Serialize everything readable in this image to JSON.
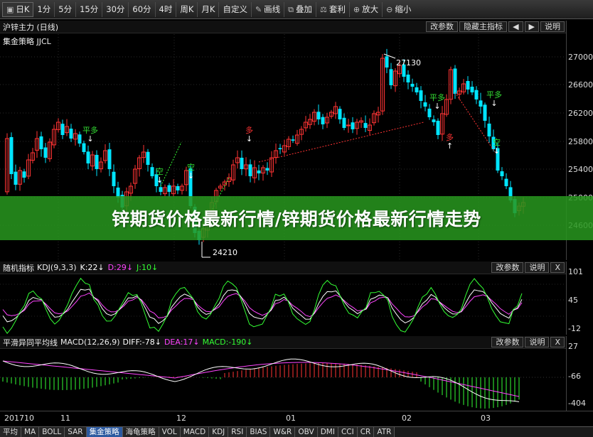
{
  "toolbar": {
    "items": [
      {
        "label": "日K",
        "icon": "checkbox-icon",
        "active": true
      },
      {
        "label": "1分"
      },
      {
        "label": "5分"
      },
      {
        "label": "15分"
      },
      {
        "label": "30分"
      },
      {
        "label": "60分"
      },
      {
        "label": "4时"
      },
      {
        "label": "周K"
      },
      {
        "label": "月K"
      },
      {
        "label": "自定义"
      },
      {
        "label": "画线",
        "icon": "pencil-icon"
      },
      {
        "label": "叠加",
        "icon": "overlay-icon"
      },
      {
        "label": "套利",
        "icon": "arbitrage-icon"
      },
      {
        "label": "放大",
        "icon": "zoom-in-icon"
      },
      {
        "label": "缩小",
        "icon": "zoom-out-icon"
      }
    ]
  },
  "main_panel": {
    "title": "沪锌主力 (日线)",
    "strategy_label": "集金策略 JJCL",
    "buttons": {
      "params": "改参数",
      "hide": "隐藏主指标",
      "prev": "◀",
      "next": "▶",
      "help": "说明"
    },
    "y_ticks": [
      "27000",
      "26600",
      "26200",
      "25800",
      "25400",
      "25000",
      "24600"
    ],
    "high_label": "27130",
    "low_label": "24210",
    "signals": [
      {
        "text": "平多",
        "color": "#33dd33"
      },
      {
        "text": "空",
        "color": "#33dd33"
      },
      {
        "text": "空",
        "color": "#33dd33"
      },
      {
        "text": "多",
        "color": "#ff3333"
      },
      {
        "text": "平多",
        "color": "#33dd33"
      },
      {
        "text": "多",
        "color": "#ff3333"
      },
      {
        "text": "平多",
        "color": "#33dd33"
      },
      {
        "text": "空",
        "color": "#33dd33"
      }
    ]
  },
  "banner": {
    "text": "锌期货价格最新行情/锌期货价格最新行情走势"
  },
  "kdj_panel": {
    "name": "随机指标",
    "params": "KDJ(9,3,3)",
    "k": "K:22↓",
    "d": "D:29↓",
    "j": "J:10↓",
    "buttons": {
      "params": "改参数",
      "help": "说明",
      "close": "X"
    },
    "y_ticks": [
      "101",
      "45",
      "-12"
    ]
  },
  "macd_panel": {
    "name": "平滑异同平均线",
    "params": "MACD(12,26,9)",
    "diff": "DIFF:-78↓",
    "dea": "DEA:17↓",
    "macd": "MACD:-190↓",
    "buttons": {
      "params": "改参数",
      "help": "说明",
      "close": "X"
    },
    "y_ticks": [
      "27",
      "-66",
      "-404"
    ]
  },
  "x_axis": {
    "labels": [
      "201710",
      "11",
      "12",
      "01",
      "02",
      "03"
    ]
  },
  "tabs": [
    {
      "label": "平均"
    },
    {
      "label": "MA"
    },
    {
      "label": "BOLL"
    },
    {
      "label": "SAR"
    },
    {
      "label": "集金策略",
      "active": true
    },
    {
      "label": "海龟策略"
    },
    {
      "label": "VOL"
    },
    {
      "label": "MACD"
    },
    {
      "label": "KDJ"
    },
    {
      "label": "RSI"
    },
    {
      "label": "BIAS"
    },
    {
      "label": "W&R"
    },
    {
      "label": "OBV"
    },
    {
      "label": "DMI"
    },
    {
      "label": "CCI"
    },
    {
      "label": "CR"
    },
    {
      "label": "ATR"
    }
  ],
  "colors": {
    "up": "#ff3333",
    "down": "#00e5ff",
    "k_line": "#ffffff",
    "d_line": "#ff44ff",
    "j_line": "#33ff33",
    "diff_line": "#ffffff",
    "dea_line": "#ff44ff",
    "banner_bg": "#2a9620",
    "active_tab": "#2c5aa0"
  }
}
